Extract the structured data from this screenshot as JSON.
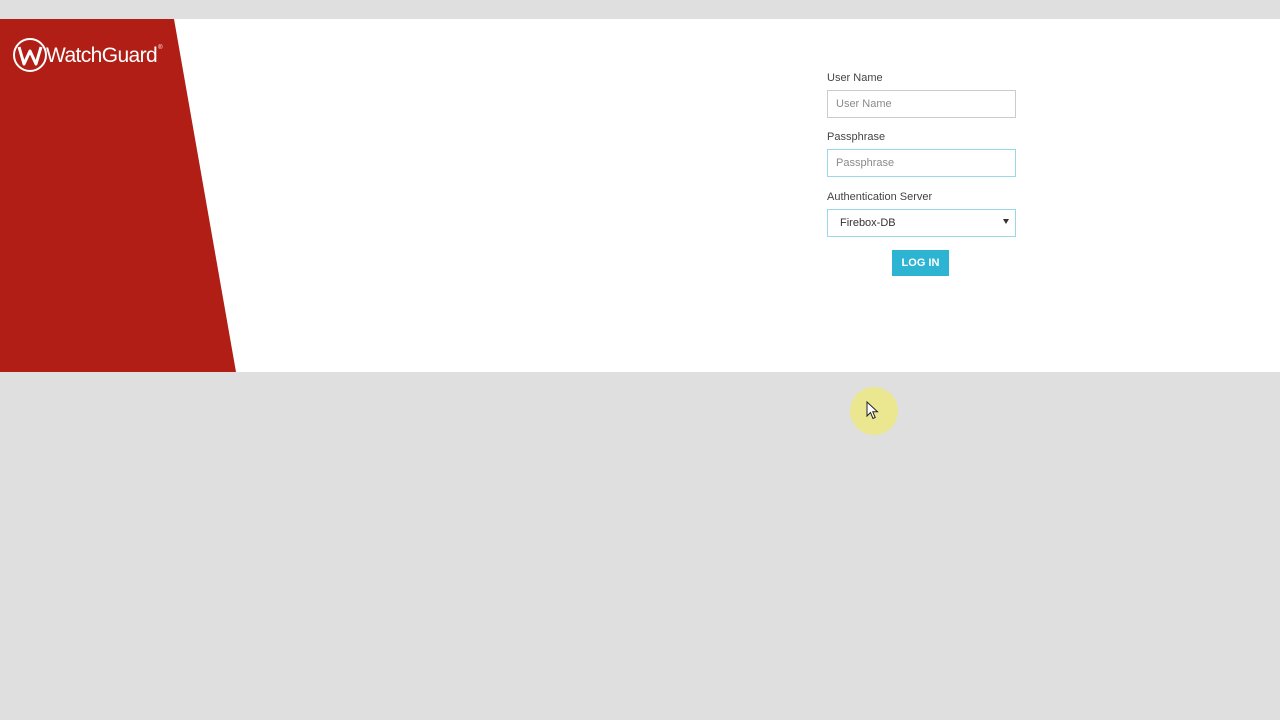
{
  "brand": {
    "name": "WatchGuard",
    "registered_mark": "®",
    "logo_icon": "watchguard-w-logo",
    "color": "#b01e16"
  },
  "form": {
    "username": {
      "label": "User Name",
      "placeholder": "User Name",
      "value": ""
    },
    "passphrase": {
      "label": "Passphrase",
      "placeholder": "Passphrase",
      "value": ""
    },
    "auth_server": {
      "label": "Authentication Server",
      "selected": "Firebox-DB"
    },
    "login_button": {
      "label": "LOG IN",
      "color": "#2eb4d3"
    }
  },
  "cursor": {
    "icon": "mouse-pointer-icon",
    "highlight_color": "#ece982"
  }
}
